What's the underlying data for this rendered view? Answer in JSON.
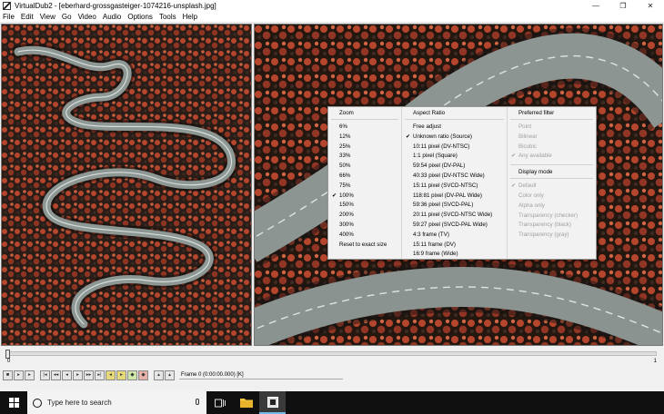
{
  "window": {
    "title": "VirtualDub2 - [eberhard-grossgasteiger-1074216-unsplash.jpg]",
    "controls": {
      "minimize": "—",
      "restore": "❐",
      "close": "✕"
    }
  },
  "menu": [
    "File",
    "Edit",
    "View",
    "Go",
    "Video",
    "Audio",
    "Options",
    "Tools",
    "Help"
  ],
  "popup": {
    "zoom": {
      "header": "Zoom",
      "items": [
        "6%",
        "12%",
        "25%",
        "33%",
        "50%",
        "66%",
        "75%",
        "100%",
        "150%",
        "200%",
        "300%",
        "400%",
        "Reset to exact size"
      ],
      "checked": "100%"
    },
    "aspect": {
      "header": "Aspect Ratio",
      "items": [
        "Free adjust",
        "Unknown ratio (Source)",
        "10:11 pixel (DV-NTSC)",
        "1:1 pixel (Square)",
        "59:54 pixel (DV-PAL)",
        "40:33 pixel (DV-NTSC Wide)",
        "15:11 pixel (SVCD-NTSC)",
        "118:81 pixel (DV-PAL Wide)",
        "59:36 pixel (SVCD-PAL)",
        "20:11 pixel (SVCD-NTSC Wide)",
        "59:27 pixel (SVCD-PAL Wide)",
        "4:3 frame (TV)",
        "15:11 frame (DV)",
        "16:9 frame (Wide)"
      ],
      "checked": "Unknown ratio (Source)"
    },
    "filter": {
      "header": "Preferred filter",
      "items": [
        "Point",
        "Bilinear",
        "Bicubic",
        "Any available"
      ],
      "checked": "Any available"
    },
    "display": {
      "header": "Display mode",
      "items": [
        "Default",
        "Color only",
        "Alpha only",
        "Transparency (checker)",
        "Transparency (black)",
        "Transparency (gray)"
      ],
      "checked": "Default"
    }
  },
  "timeline": {
    "start_label": "0",
    "end_label": "1",
    "position": 0
  },
  "toolbar": {
    "frame_label": "Frame 0 (0:00:00.000) [K]",
    "buttons": [
      "stop-icon",
      "play-input-icon",
      "play-output-icon",
      "start-icon",
      "prev-key-icon",
      "prev-frame-icon",
      "next-frame-icon",
      "next-key-icon",
      "end-icon",
      "scene-back-icon",
      "scene-fwd-icon",
      "mark-in-icon",
      "mark-out-icon",
      "zoom-in-icon",
      "zoom-out-icon"
    ]
  },
  "taskbar": {
    "search_placeholder": "Type here to search"
  },
  "colors": {
    "foliage": "#b5452c",
    "dark": "#1d1612",
    "road": "#9aa3a0",
    "taskbar": "#101010",
    "accent": "#76b9ed"
  }
}
